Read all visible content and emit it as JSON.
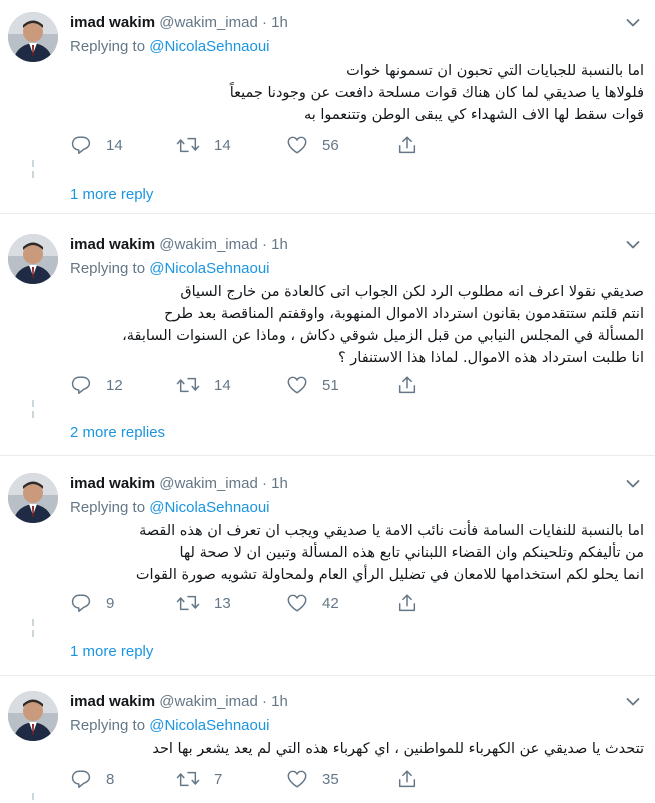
{
  "tweets": [
    {
      "name": "imad wakim",
      "handle": "@wakim_imad",
      "dot": "·",
      "time": "1h",
      "replying_prefix": "Replying to ",
      "replying_to": "@NicolaSehnaoui",
      "lines": [
        "اما بالنسبة للجبايات التي تحبون ان تسمونها خوات",
        "فلولاها يا صديقي لما كان هناك قوات مسلحة دافعت عن وجودنا جميعاً",
        "قوات سقط لها الاف الشهداء كي يبقى الوطن وتتنعموا به"
      ],
      "replies": "14",
      "retweets": "14",
      "likes": "56",
      "more_replies": "1 more reply"
    },
    {
      "name": "imad wakim",
      "handle": "@wakim_imad",
      "dot": "·",
      "time": "1h",
      "replying_prefix": "Replying to ",
      "replying_to": "@NicolaSehnaoui",
      "lines": [
        "صديقي نقولا اعرف انه مطلوب  الرد لكن الجواب اتى كالعادة من خارج السياق",
        "انتم قلتم ستتقدمون بقانون استرداد الاموال المنهوبة، واوقفتم المناقصة بعد طرح",
        "المسألة في المجلس النيابي من قبل الزميل شوقي دكاش ، وماذا عن السنوات السابقة،",
        "انا طلبت استرداد هذه الاموال. لماذا هذا الاستنفار ؟"
      ],
      "replies": "12",
      "retweets": "14",
      "likes": "51",
      "more_replies": "2 more replies"
    },
    {
      "name": "imad wakim",
      "handle": "@wakim_imad",
      "dot": "·",
      "time": "1h",
      "replying_prefix": "Replying to ",
      "replying_to": "@NicolaSehnaoui",
      "lines": [
        "اما بالنسبة للنفايات السامة فأنت نائب الامة يا صديقي ويجب ان تعرف ان هذه القصة",
        "من تأليفكم وتلحينكم وان القضاء اللبناني تابع هذه المسألة وتبين ان لا صحة لها",
        "انما يحلو  لكم استخدامها للامعان في تضليل الرأي العام ولمحاولة تشويه صورة القوات"
      ],
      "replies": "9",
      "retweets": "13",
      "likes": "42",
      "more_replies": "1 more reply"
    },
    {
      "name": "imad wakim",
      "handle": "@wakim_imad",
      "dot": "·",
      "time": "1h",
      "replying_prefix": "Replying to ",
      "replying_to": "@NicolaSehnaoui",
      "lines": [
        "تتحدث يا صديقي عن الكهرباء للمواطنين ، اي كهرباء هذه التي لم يعد يشعر بها احد"
      ],
      "replies": "8",
      "retweets": "7",
      "likes": "35",
      "more_replies": ""
    }
  ],
  "colors": {
    "name": "#14171a",
    "secondary": "#657786",
    "link": "#1b95e0",
    "separator": "#e6ecf0",
    "thread_line": "#ccd6dd"
  },
  "icons": [
    "chevron-down-icon",
    "reply-icon",
    "retweet-icon",
    "like-icon",
    "share-icon"
  ]
}
